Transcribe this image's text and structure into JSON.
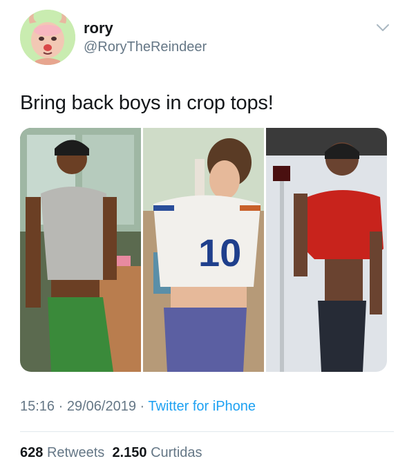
{
  "user": {
    "display_name": "rory",
    "handle": "@RoryTheReindeer",
    "avatar_icon": "reindeer-avatar",
    "avatar_bg": "#c9ecb0"
  },
  "tweet": {
    "text": "Bring back boys in crop tops!",
    "time": "15:16",
    "separator": "·",
    "date": "29/06/2019",
    "source": "Twitter for iPhone"
  },
  "stats": {
    "retweets_count": "628",
    "retweets_label": "Retweets",
    "likes_count": "2.150",
    "likes_label": "Curtidas"
  },
  "media": {
    "photos": [
      {
        "icon": "photo-man-green-pants"
      },
      {
        "icon": "photo-man-jersey-10"
      },
      {
        "icon": "photo-man-red-top"
      }
    ],
    "jersey_number": "10"
  },
  "colors": {
    "text": "#14171a",
    "secondary": "#657786",
    "link": "#1da1f2",
    "divider": "#e1e8ed"
  }
}
